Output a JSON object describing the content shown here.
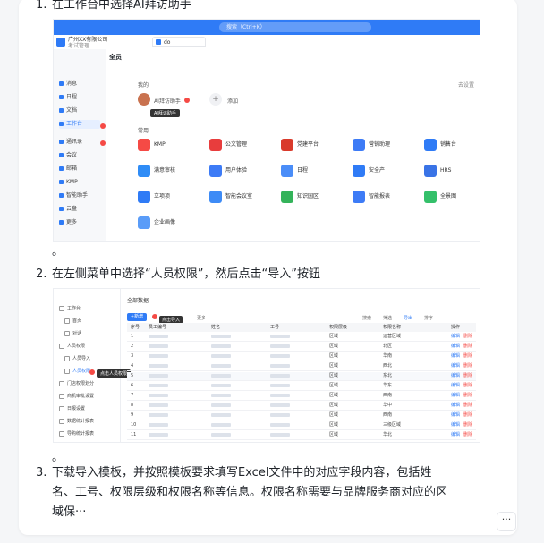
{
  "steps": [
    {
      "num": "1.",
      "text": "在工作台中选择AI拜访助手"
    },
    {
      "num": "2.",
      "text": "在左侧菜单中选择“人员权限”，然后点击“导入”按钮"
    },
    {
      "num": "3.",
      "lines": [
        "下载导入模板，并按照模板要求填写Excel文件中的对应字段内容，包括姓",
        "名、工号、权限层级和权限名称等信息。权限名称需要与品牌服务商对应的区",
        "域保···"
      ]
    }
  ],
  "dot": "。",
  "more_button": "···",
  "shot1": {
    "search": "搜索（Ctrl+K）",
    "brand": "广州XX有限公司",
    "brand_sub": "考试管理",
    "tab": "do",
    "all": "全员",
    "mine": "我的",
    "recent_app": "AI拜访助手",
    "add": "添加",
    "tooltip": "AI拜访助手",
    "common": "常用",
    "manage": "去设置",
    "nav": [
      "消息",
      "日程",
      "文档",
      "工作台",
      "通讯录",
      "会议",
      "邮箱",
      "KMP",
      "智能助手",
      "云盘",
      "更多"
    ],
    "apps": [
      [
        "KMP",
        "公文管理",
        "党建平台",
        "营销助理",
        "销售台"
      ],
      [
        "满意审核",
        "用户体验",
        "日程",
        "安全产",
        "HRS"
      ],
      [
        "立项项",
        "智能会议室",
        "知识园区",
        "智能报表",
        "全景图"
      ],
      [
        "企业画像"
      ]
    ],
    "colors": {
      "primary": "#2f7bf6",
      "badge": "#f54a45"
    }
  },
  "shot2": {
    "side": [
      "工作台",
      "首页",
      "对话",
      "人员权限",
      "人员导入",
      "人员权限",
      "门店权限划分",
      "商机审批设置",
      "日报设置",
      "数据统计报表",
      "导购统计报表"
    ],
    "tip": "点击人员权限",
    "title": "全部数据",
    "new_btn": "+新增",
    "import_tip": "点击导入",
    "toolbar": [
      "批量删除",
      "更多",
      "搜索",
      "筛选",
      "导出",
      "排序"
    ],
    "headers": [
      "序号",
      "员工编号",
      "姓名",
      "工号",
      "权限层级",
      "权限名称",
      "操作"
    ],
    "rows": [
      [
        "1",
        "区域",
        "运营区域",
        "编辑"
      ],
      [
        "2",
        "区域",
        "北区",
        "编辑"
      ],
      [
        "3",
        "区域",
        "华南",
        "编辑"
      ],
      [
        "4",
        "区域",
        "西北",
        "编辑"
      ],
      [
        "5",
        "区域",
        "东北",
        "编辑"
      ],
      [
        "6",
        "区域",
        "华东",
        "编辑"
      ],
      [
        "7",
        "区域",
        "西南",
        "编辑"
      ],
      [
        "8",
        "区域",
        "华中",
        "编辑"
      ],
      [
        "9",
        "区域",
        "西南",
        "编辑"
      ],
      [
        "10",
        "区域",
        "三级区域",
        "编辑"
      ],
      [
        "11",
        "区域",
        "华北",
        "编辑"
      ]
    ],
    "delete": "删除"
  }
}
